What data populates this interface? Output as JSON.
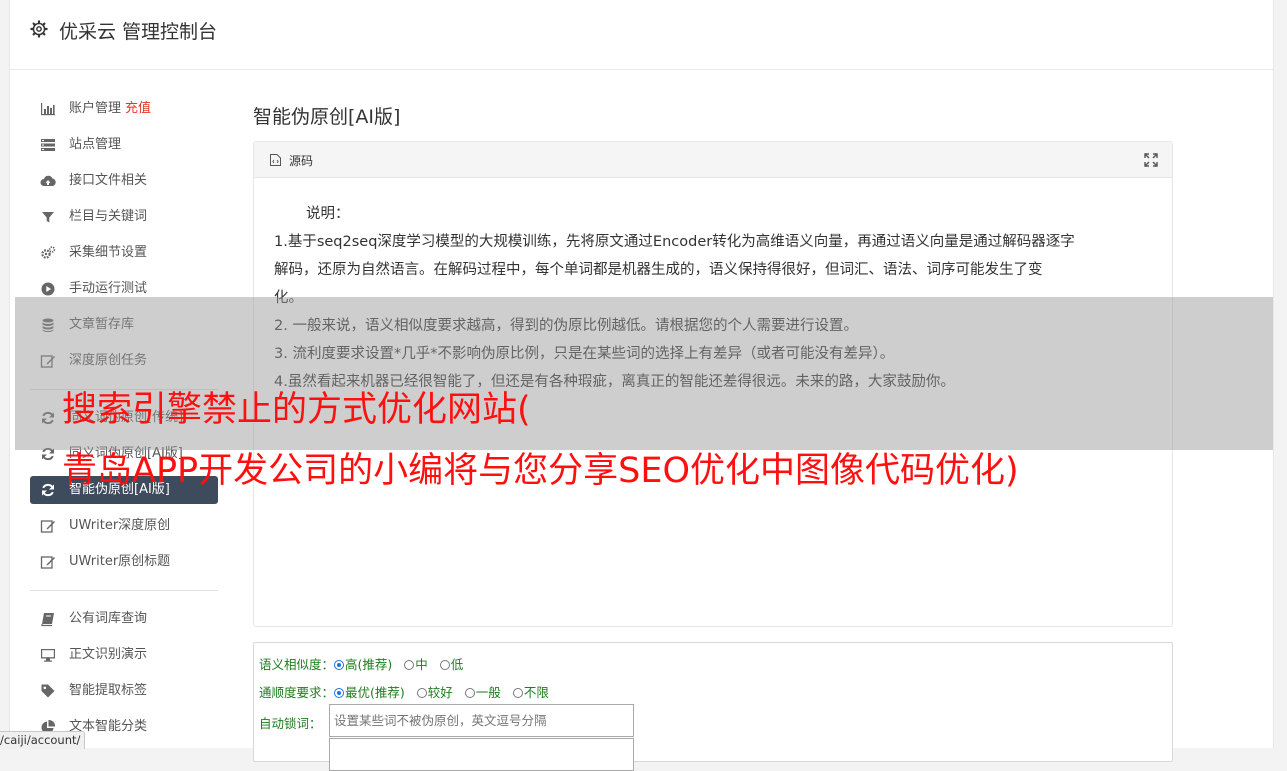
{
  "header": {
    "title": "优采云 管理控制台"
  },
  "sidebar": {
    "items": [
      {
        "label": "账户管理",
        "badge": "充值",
        "icon": "bar-chart-icon"
      },
      {
        "label": "站点管理",
        "icon": "list-icon"
      },
      {
        "label": "接口文件相关",
        "icon": "cloud-upload-icon"
      },
      {
        "label": "栏目与关键词",
        "icon": "filter-icon"
      },
      {
        "label": "采集细节设置",
        "icon": "gears-icon"
      },
      {
        "label": "手动运行测试",
        "icon": "play-circle-icon"
      },
      {
        "label": "文章暂存库",
        "icon": "database-icon"
      },
      {
        "label": "深度原创任务",
        "icon": "edit-icon"
      },
      {
        "label": "同义词伪原创[传统]",
        "icon": "refresh-icon"
      },
      {
        "label": "同义词伪原创[AI版]",
        "icon": "refresh-icon"
      },
      {
        "label": "智能伪原创[AI版]",
        "icon": "refresh-icon",
        "active": true
      },
      {
        "label": "UWriter深度原创",
        "icon": "edit-icon"
      },
      {
        "label": "UWriter原创标题",
        "icon": "edit-icon"
      },
      {
        "label": "公有词库查询",
        "icon": "book-icon"
      },
      {
        "label": "正文识别演示",
        "icon": "monitor-icon"
      },
      {
        "label": "智能提取标签",
        "icon": "tag-icon"
      },
      {
        "label": "文本智能分类",
        "icon": "pie-chart-icon"
      }
    ]
  },
  "main": {
    "title": "智能伪原创[AI版]",
    "panel": {
      "header_label": "源码",
      "lines": [
        "说明：",
        "1.基于seq2seq深度学习模型的大规模训练，先将原文通过Encoder转化为高维语义向量，再通过语义向量是通过解码器逐字",
        "解码，还原为自然语言。在解码过程中，每个单词都是机器生成的，语义保持得很好，但词汇、语法、词序可能发生了变",
        "化。",
        "2. 一般来说，语义相似度要求越高，得到的伪原比例越低。请根据您的个人需要进行设置。",
        "3. 流利度要求设置*几乎*不影响伪原比例，只是在某些词的选择上有差异（或者可能没有差异）。",
        "4.虽然看起来机器已经很智能了，但还是有各种瑕疵，离真正的智能还差得很远。未来的路，大家鼓励你。"
      ]
    },
    "form": {
      "similarity": {
        "label": "语义相似度：",
        "options": [
          "高(推荐)",
          "中",
          "低"
        ],
        "selected": "高(推荐)"
      },
      "fluency": {
        "label": "通顺度要求：",
        "options": [
          "最优(推荐)",
          "较好",
          "一般",
          "不限"
        ],
        "selected": "最优(推荐)"
      },
      "lock_words": {
        "label": "自动锁词：",
        "placeholder": "设置某些词不被伪原创，英文逗号分隔"
      }
    }
  },
  "overlay": {
    "line1": "搜索引擎禁止的方式优化网站(",
    "line2": "青岛APP开发公司的小编将与您分享SEO优化中图像代码优化)"
  },
  "status_bar": {
    "url": "/caiji/account/"
  },
  "colors": {
    "active_nav": "#3d4b5c",
    "badge": "#e8352a",
    "headline": "#ff1010",
    "form_label": "#1e7d1e"
  }
}
